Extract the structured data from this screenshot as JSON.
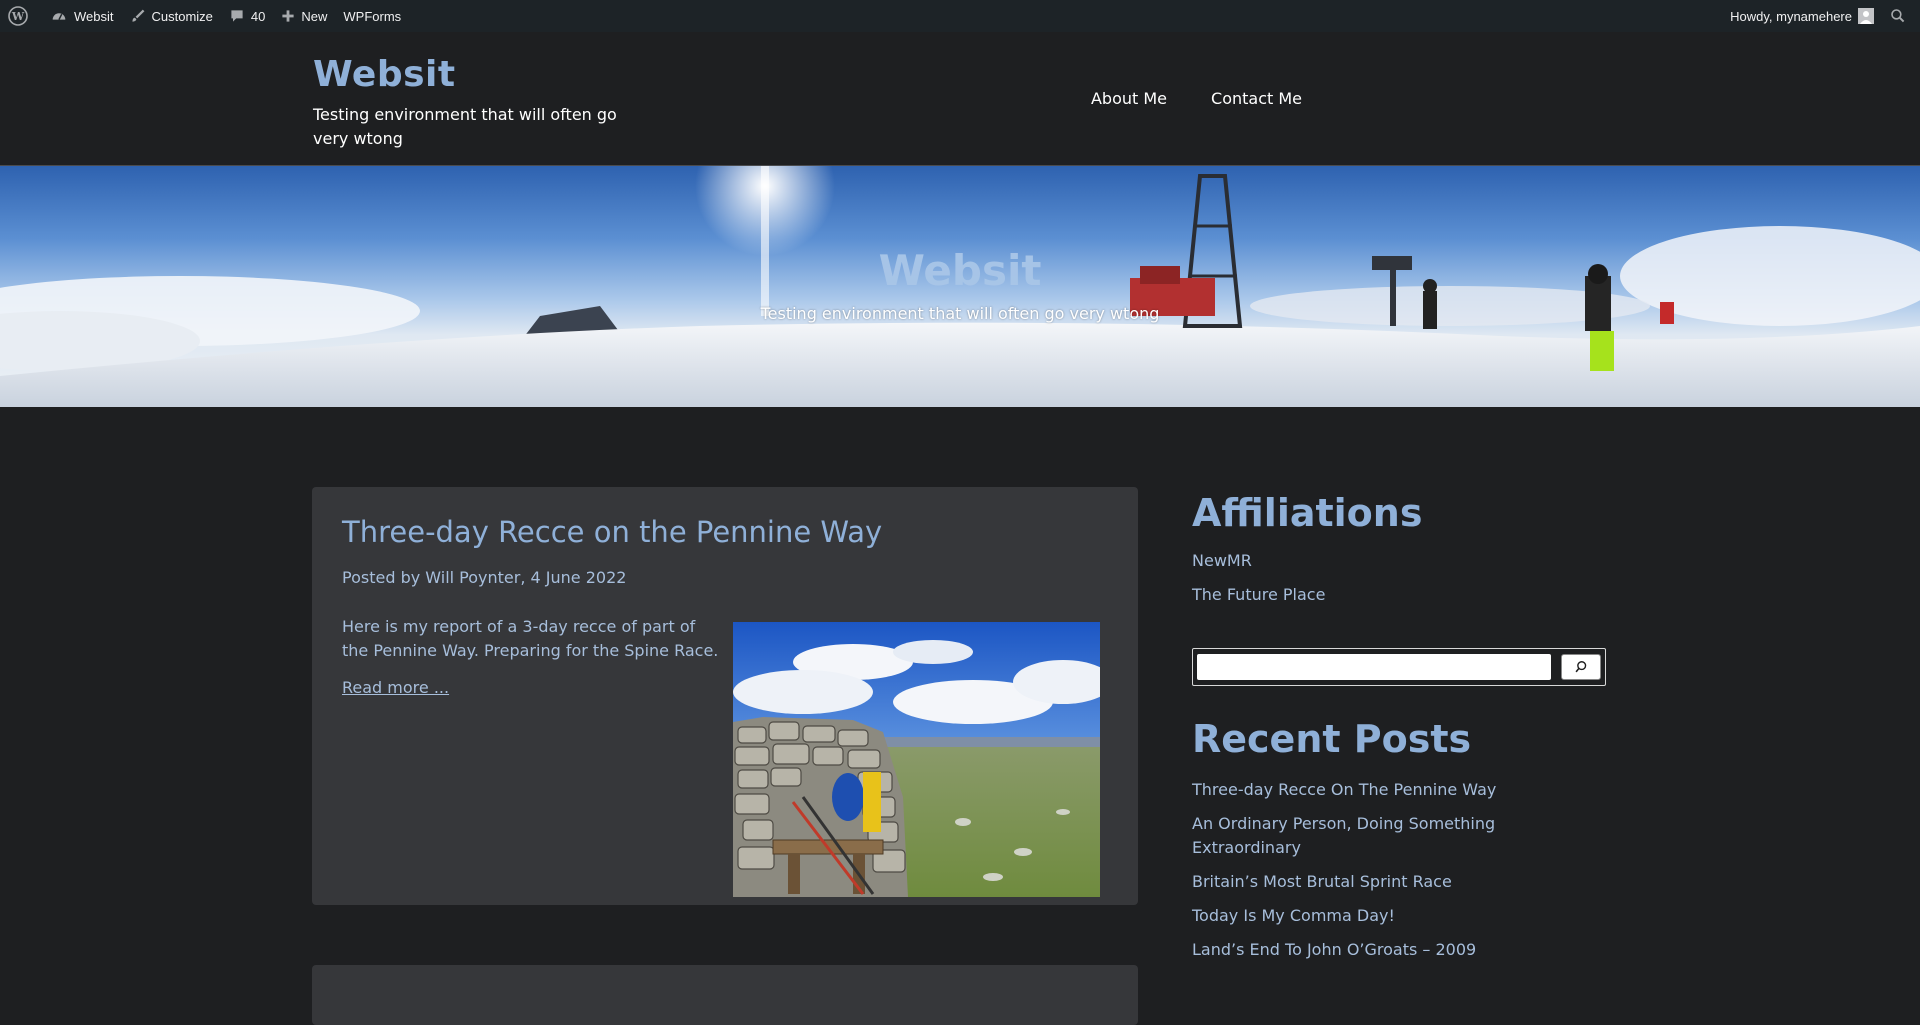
{
  "adminbar": {
    "site_name": "Websit",
    "customize": "Customize",
    "comments_count": "40",
    "new_label": "New",
    "wpforms": "WPForms",
    "howdy": "Howdy, mynamehere"
  },
  "header": {
    "site_title": "Websit",
    "tagline": "Testing environment that will often go very wtong",
    "nav": [
      "About Me",
      "Contact Me"
    ]
  },
  "hero": {
    "title": "Websit",
    "tagline": "Testing environment that will often go very wtong"
  },
  "post": {
    "title": "Three-day Recce on the Pennine Way",
    "meta_prefix": "Posted by ",
    "author": "Will Poynter",
    "meta_sep": ", ",
    "date": "4 June 2022",
    "excerpt": "Here is my report of a 3-day recce of part of the Pennine Way. Preparing for the Spine Race.",
    "read_more": "Read more ..."
  },
  "sidebar": {
    "affiliations_title": "Affiliations",
    "affiliations": [
      "NewMR",
      "The Future Place"
    ],
    "search_placeholder": "",
    "recent_title": "Recent Posts",
    "recent_posts": [
      "Three-day Recce On The Pennine Way",
      "An Ordinary Person, Doing Something Extraordinary",
      "Britain’s Most Brutal Sprint Race",
      "Today Is My Comma Day!",
      "Land’s End To John O’Groats – 2009"
    ]
  },
  "colors": {
    "background": "#1e1f21",
    "card": "#36373a",
    "accent": "#8fb0d8",
    "link": "#a7bedb",
    "adminbar": "#1d2327"
  }
}
